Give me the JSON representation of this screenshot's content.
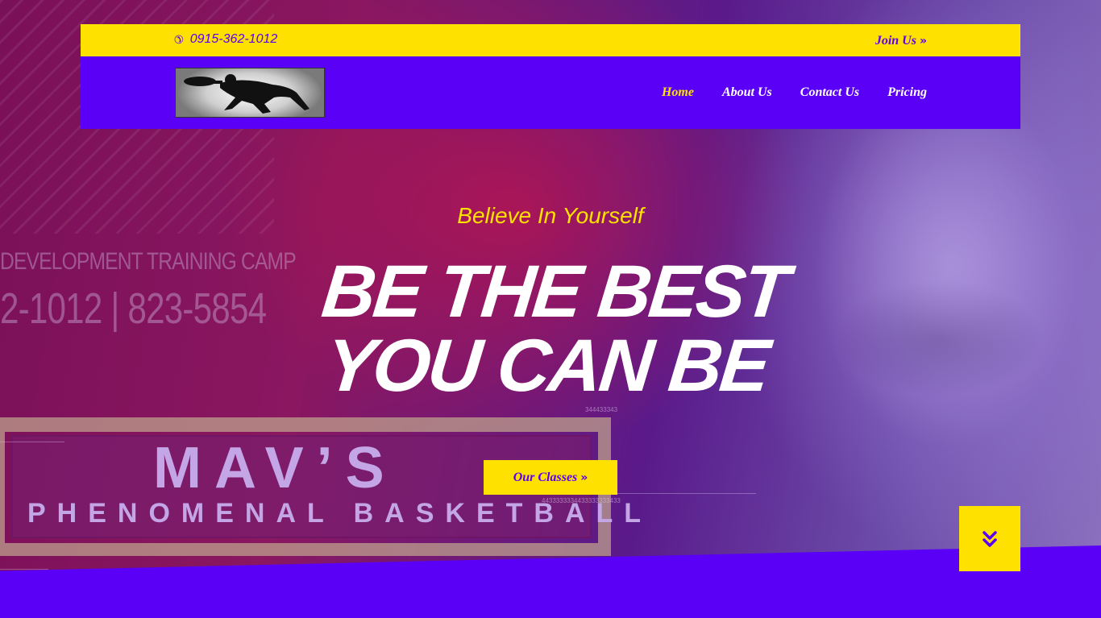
{
  "topbar": {
    "phone_icon": "phone-icon",
    "phone": "0915-362-1012",
    "join_label": "Join Us",
    "join_icon": "double-chevron-right-icon"
  },
  "navbar": {
    "logo_icon": "basketball-player-silhouette-logo",
    "links": [
      {
        "label": "Home",
        "active": true
      },
      {
        "label": "About Us",
        "active": false
      },
      {
        "label": "Contact Us",
        "active": false
      },
      {
        "label": "Pricing",
        "active": false
      }
    ]
  },
  "hero": {
    "tagline": "Believe In Yourself",
    "headline_line1": "BE THE BEST",
    "headline_line2": "YOU CAN BE",
    "cta_label": "Our Classes",
    "cta_icon": "double-chevron-right-icon",
    "scroll_icon": "double-chevron-down-icon"
  },
  "background_art": {
    "line1": "DEVELOPMENT TRAINING CAMP",
    "line2": "2-1012 | 823-5854",
    "brand_title": "MAV’S",
    "brand_subtitle": "PHENOMENAL BASKETBALL",
    "small_number_1": "344433343",
    "small_number_2": "4433333334433333333433"
  },
  "colors": {
    "accent_yellow": "#ffe100",
    "brand_purple": "#5a00f6",
    "text_white": "#ffffff"
  }
}
